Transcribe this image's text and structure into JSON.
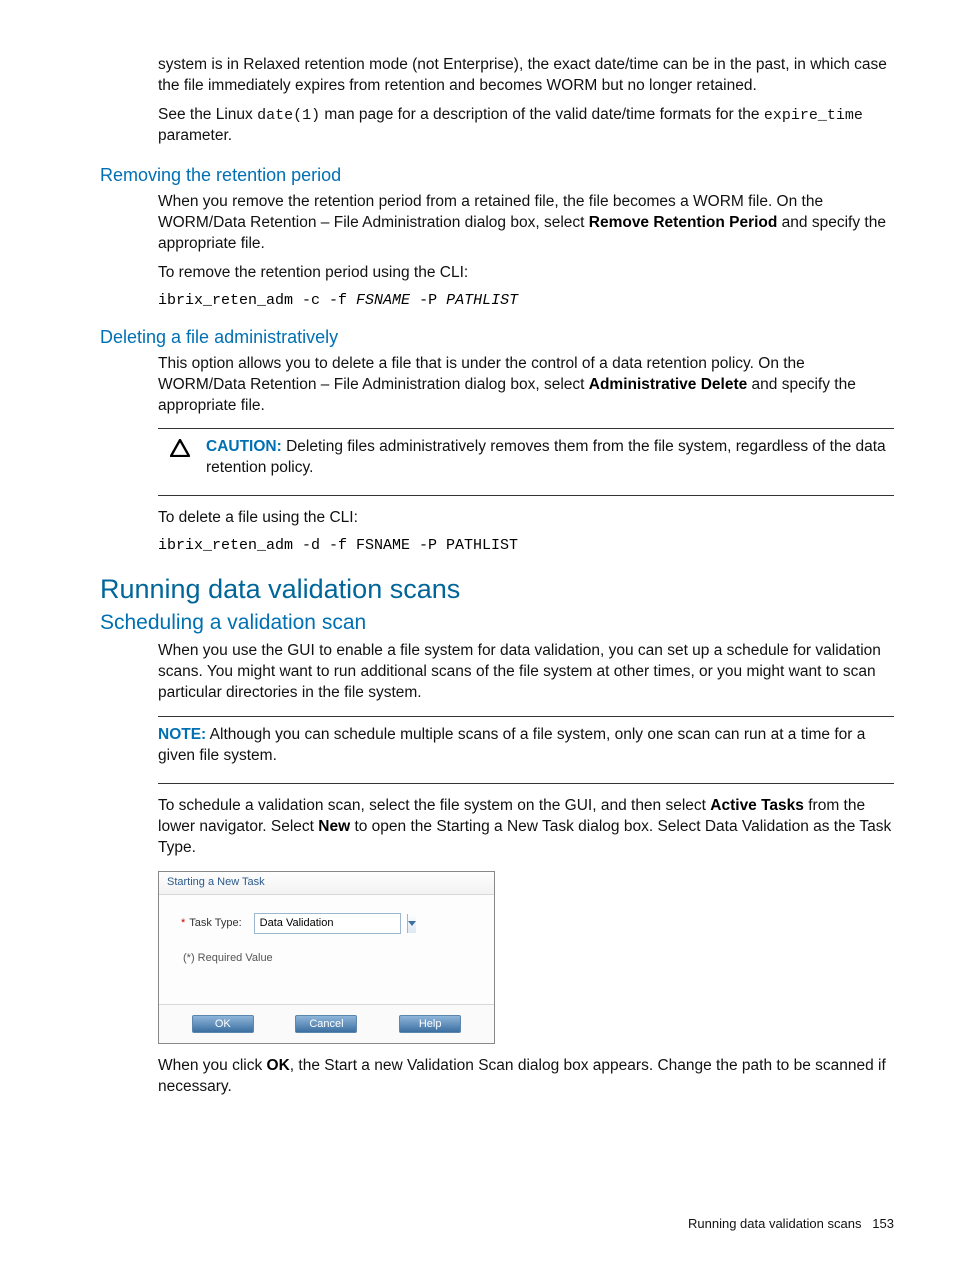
{
  "intro": {
    "p1": "system is in Relaxed retention mode (not Enterprise), the exact date/time can be in the past, in which case the file immediately expires from retention and becomes WORM but no longer retained.",
    "p2_a": "See the Linux ",
    "p2_code": "date(1)",
    "p2_b": " man page for a description of the valid date/time formats for the ",
    "p2_code2": "expire_time",
    "p2_c": " parameter."
  },
  "removing": {
    "heading": "Removing the retention period",
    "p1_a": "When you remove the retention period from a retained file, the file becomes a WORM file. On the WORM/Data Retention – File Administration dialog box, select ",
    "p1_bold": "Remove Retention Period",
    "p1_b": " and specify the appropriate file.",
    "p2": "To remove the retention period using the CLI:",
    "cmd_a": "ibrix_reten_adm -c -f ",
    "cmd_fs": "FSNAME",
    "cmd_b": " -P ",
    "cmd_path": "PATHLIST"
  },
  "deleting": {
    "heading": "Deleting a file administratively",
    "p1_a": "This option allows you to delete a file that is under the control of a data retention policy. On the WORM/Data Retention – File Administration dialog box, select ",
    "p1_bold": "Administrative Delete",
    "p1_b": " and specify the appropriate file.",
    "caution_label": "CAUTION:",
    "caution_text": "   Deleting files administratively removes them from the file system, regardless of the data retention policy.",
    "p2": "To delete a file using the CLI:",
    "cmd": "ibrix_reten_adm -d -f FSNAME -P PATHLIST"
  },
  "running": {
    "heading": "Running data validation scans"
  },
  "scheduling": {
    "heading": "Scheduling a validation scan",
    "p1": "When you use the GUI to enable a file system for data validation, you can set up a schedule for validation scans. You might want to run additional scans of the file system at other times, or you might want to scan particular directories in the file system.",
    "note_label": "NOTE:",
    "note_text": "   Although you can schedule multiple scans of a file system, only one scan can run at a time for a given file system.",
    "p2_a": "To schedule a validation scan, select the file system on the GUI, and then select ",
    "p2_bold1": "Active Tasks",
    "p2_b": " from the lower navigator. Select ",
    "p2_bold2": "New",
    "p2_c": " to open the Starting a New Task dialog box. Select Data Validation as the Task Type.",
    "p3_a": "When you click ",
    "p3_bold": "OK",
    "p3_b": ", the Start a new Validation Scan dialog box appears. Change the path to be scanned if necessary."
  },
  "dialog": {
    "title": "Starting a New Task",
    "field_label": "Task Type:",
    "combo_value": "Data Validation",
    "required": "(*) Required Value",
    "btn_ok": "OK",
    "btn_cancel": "Cancel",
    "btn_help": "Help"
  },
  "footer": {
    "text": "Running data validation scans",
    "page": "153"
  }
}
